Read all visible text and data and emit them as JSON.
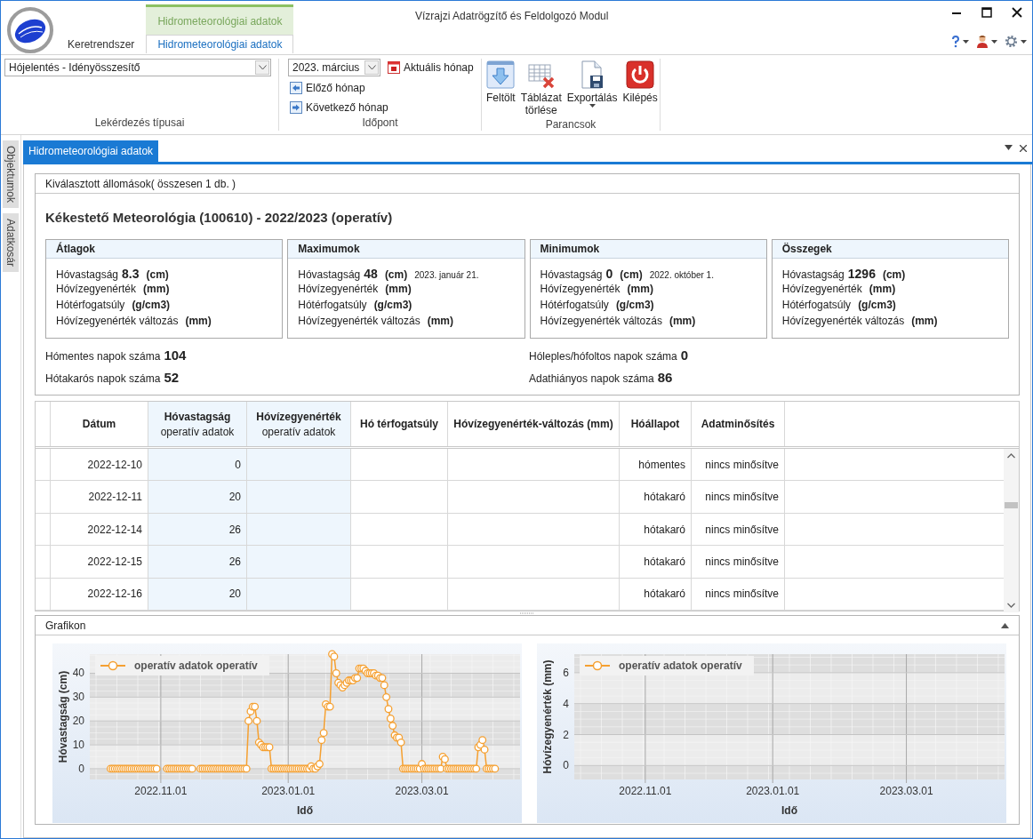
{
  "window": {
    "title": "Vízrajzi Adatrögzítő és Feldolgozó Modul"
  },
  "ribbon": {
    "context_tab_group": "Hidrometeorológiai adatok",
    "tabs": [
      {
        "label": "Keretrendszer",
        "selected": false
      },
      {
        "label": "Hidrometeorológiai adatok",
        "selected": true
      }
    ],
    "query_group": {
      "label": "Lekérdezés típusai",
      "dropdown": "Hójelentés - Idényösszesítő"
    },
    "date_group": {
      "label": "Időpont",
      "dropdown": "2023. március",
      "buttons": [
        "Aktuális hónap",
        "Előző hónap",
        "Következő hónap"
      ]
    },
    "commands_group": {
      "label": "Parancsok",
      "buttons": [
        {
          "label": "Feltölt",
          "has_menu": false
        },
        {
          "label": "Táblázat törlése",
          "has_menu": false
        },
        {
          "label": "Exportálás",
          "has_menu": true
        },
        {
          "label": "Kilépés",
          "has_menu": false
        }
      ]
    }
  },
  "side_tabs": [
    "Objektumok",
    "Adatkosár"
  ],
  "document_tab": {
    "label": "Hidrometeorológiai adatok"
  },
  "station_panel": {
    "header": "Kiválasztott állomások( összesen 1 db. )",
    "title": "Kékestető Meteorológia (100610) - 2022/2023 (operatív)",
    "cards": [
      {
        "title": "Átlagok",
        "rows": [
          {
            "label": "Hóvastagság",
            "value": "8.3",
            "unit": "(cm)"
          },
          {
            "label": "Hóvízegyenérték",
            "unit": "(mm)"
          },
          {
            "label": "Hótérfogatsúly",
            "unit": "(g/cm3)"
          },
          {
            "label": "Hóvízegyenérték változás",
            "unit": "(mm)"
          }
        ]
      },
      {
        "title": "Maximumok",
        "rows": [
          {
            "label": "Hóvastagság",
            "value": "48",
            "unit": "(cm)",
            "note": "2023. január 21."
          },
          {
            "label": "Hóvízegyenérték",
            "unit": "(mm)"
          },
          {
            "label": "Hótérfogatsúly",
            "unit": "(g/cm3)"
          },
          {
            "label": "Hóvízegyenérték változás",
            "unit": "(mm)"
          }
        ]
      },
      {
        "title": "Minimumok",
        "rows": [
          {
            "label": "Hóvastagság",
            "value": "0",
            "unit": "(cm)",
            "note": "2022. október 1."
          },
          {
            "label": "Hóvízegyenérték",
            "unit": "(mm)"
          },
          {
            "label": "Hótérfogatsúly",
            "unit": "(g/cm3)"
          },
          {
            "label": "Hóvízegyenérték változás",
            "unit": "(mm)"
          }
        ]
      },
      {
        "title": "Összegek",
        "rows": [
          {
            "label": "Hóvastagság",
            "value": "1296",
            "unit": "(cm)"
          },
          {
            "label": "Hóvízegyenérték",
            "unit": "(mm)"
          },
          {
            "label": "Hótérfogatsúly",
            "unit": "(g/cm3)"
          },
          {
            "label": "Hóvízegyenérték változás",
            "unit": "(mm)"
          }
        ]
      }
    ],
    "day_counts": [
      {
        "label": "Hómentes napok száma",
        "value": "104"
      },
      {
        "label": "Hóleples/hófoltos napok száma",
        "value": "0"
      },
      {
        "label": "Hótakarós napok száma",
        "value": "52"
      },
      {
        "label": "Adathiányos napok száma",
        "value": "86"
      }
    ]
  },
  "table": {
    "columns": [
      {
        "title": "Dátum",
        "highlighted": false
      },
      {
        "title": "Hóvastagság",
        "subtitle": "operatív adatok",
        "highlighted": true
      },
      {
        "title": "Hóvízegyenérték",
        "subtitle": "operatív adatok",
        "highlighted": true
      },
      {
        "title": "Hó térfogatsúly",
        "highlighted": false
      },
      {
        "title": "Hóvízegyenérték-változás (mm)",
        "highlighted": false
      },
      {
        "title": "Hóállapot",
        "highlighted": false
      },
      {
        "title": "Adatminősítés",
        "highlighted": false
      }
    ],
    "rows": [
      {
        "date": "2022-12-10",
        "snow_depth": "0",
        "snow_state": "hómentes",
        "qualification": "nincs minősítve"
      },
      {
        "date": "2022-12-11",
        "snow_depth": "20",
        "snow_state": "hótakaró",
        "qualification": "nincs minősítve"
      },
      {
        "date": "2022-12-14",
        "snow_depth": "26",
        "snow_state": "hótakaró",
        "qualification": "nincs minősítve"
      },
      {
        "date": "2022-12-15",
        "snow_depth": "26",
        "snow_state": "hótakaró",
        "qualification": "nincs minősítve"
      },
      {
        "date": "2022-12-16",
        "snow_depth": "20",
        "snow_state": "hótakaró",
        "qualification": "nincs minősítve"
      }
    ]
  },
  "chart_panel": {
    "title": "Grafikon",
    "charts": [
      {
        "chart_data": {
          "type": "line",
          "grid": true,
          "xlabel": "Idő",
          "ylabel": "Hóvastagság (cm)",
          "ylim": [
            -4.5,
            48
          ],
          "yticks": [
            0,
            10,
            20,
            30,
            40
          ],
          "categories": [
            null,
            null,
            null,
            null,
            null,
            null,
            null,
            null,
            null,
            null,
            null,
            null,
            null,
            null,
            null,
            null,
            null,
            null,
            null,
            null,
            null,
            null,
            null,
            null,
            null,
            null,
            null,
            null,
            null,
            null,
            null,
            "2022.11.01",
            null,
            null,
            null,
            null,
            null,
            null,
            null,
            null,
            null,
            null,
            null,
            null,
            null,
            null,
            null,
            null,
            null,
            null,
            null,
            null,
            null,
            null,
            null,
            null,
            null,
            null,
            null,
            null,
            null,
            null,
            null,
            null,
            null,
            null,
            null,
            null,
            null,
            null,
            null,
            null,
            null,
            null,
            null,
            null,
            null,
            null,
            null,
            null,
            null,
            null,
            null,
            null,
            null,
            null,
            null,
            null,
            null,
            null,
            null,
            null,
            "2023.01.01",
            null,
            null,
            null,
            null,
            null,
            null,
            null,
            null,
            null,
            null,
            null,
            null,
            null,
            null,
            null,
            null,
            null,
            null,
            null,
            null,
            null,
            null,
            null,
            null,
            null,
            null,
            null,
            null,
            null,
            null,
            null,
            null,
            null,
            null,
            null,
            null,
            null,
            null,
            null,
            null,
            null,
            null,
            null,
            null,
            null,
            null,
            null,
            null,
            null,
            null,
            null,
            null,
            null,
            null,
            null,
            null,
            null,
            null,
            null,
            null,
            null,
            null,
            null,
            "2023.03.01",
            null,
            null,
            null,
            null,
            null,
            null,
            null,
            null,
            null,
            null,
            null,
            null,
            null,
            null,
            null,
            null,
            null,
            null,
            null,
            null,
            null,
            null,
            null,
            null,
            null,
            null,
            null,
            null,
            null,
            null,
            null,
            null,
            null,
            null,
            null,
            null,
            null,
            null,
            null,
            null,
            null,
            null,
            null,
            null
          ],
          "series": [
            {
              "name": "operatív adatok operatív",
              "color": "#f5a031",
              "marker": "circle",
              "values": [
                null,
                null,
                null,
                null,
                null,
                null,
                null,
                0,
                0,
                0,
                0,
                0,
                0,
                0,
                0,
                0,
                0,
                0,
                0,
                0,
                0,
                0,
                0,
                0,
                0,
                0,
                0,
                0,
                0,
                0,
                null,
                null,
                null,
                null,
                0,
                0,
                0,
                0,
                0,
                0,
                0,
                0,
                0,
                0,
                0,
                0,
                0,
                null,
                null,
                null,
                0,
                0,
                0,
                0,
                0,
                0,
                0,
                0,
                0,
                0,
                0,
                0,
                0,
                0,
                0,
                0,
                0,
                0,
                0,
                0,
                0,
                0,
                0,
                20,
                24,
                26,
                26,
                20,
                11,
                10,
                9,
                9,
                9,
                9,
                0,
                0,
                0,
                0,
                0,
                0,
                0,
                0,
                0,
                0,
                0,
                0,
                0,
                0,
                0,
                0,
                0,
                0,
                0,
                1,
                0,
                0,
                1,
                2,
                12,
                15,
                27,
                26,
                26,
                48,
                47,
                40,
                36,
                35,
                34,
                35,
                36,
                37,
                37,
                37,
                38,
                38,
                42,
                42,
                42,
                41,
                40,
                40,
                40,
                40,
                39,
                39,
                38,
                38,
                35,
                30,
                25,
                21,
                18,
                14,
                13,
                13,
                11,
                0,
                0,
                0,
                0,
                0,
                0,
                0,
                0,
                0,
                2,
                0,
                0,
                0,
                0,
                0,
                0,
                0,
                0,
                0,
                5,
                4,
                0,
                0,
                0,
                0,
                0,
                0,
                0,
                0,
                0,
                0,
                0,
                0,
                0,
                0,
                0,
                9,
                10,
                12,
                8,
                0,
                0,
                0,
                0,
                0,
                null,
                null,
                null,
                null,
                null,
                null,
                null,
                null,
                null
              ]
            }
          ]
        }
      },
      {
        "chart_data": {
          "type": "line",
          "grid": true,
          "xlabel": "Idő",
          "ylabel": "Hóvízegyenérték (mm)",
          "ylim": [
            -0.9,
            7.2
          ],
          "yticks": [
            0,
            2,
            4,
            6
          ],
          "categories": [
            null,
            null,
            null,
            null,
            null,
            null,
            null,
            null,
            null,
            null,
            null,
            null,
            null,
            null,
            null,
            null,
            null,
            null,
            null,
            null,
            null,
            null,
            null,
            null,
            null,
            null,
            null,
            null,
            null,
            null,
            null,
            "2022.11.01",
            null,
            null,
            null,
            null,
            null,
            null,
            null,
            null,
            null,
            null,
            null,
            null,
            null,
            null,
            null,
            null,
            null,
            null,
            null,
            null,
            null,
            null,
            null,
            null,
            null,
            null,
            null,
            null,
            null,
            null,
            null,
            null,
            null,
            null,
            null,
            null,
            null,
            null,
            null,
            null,
            null,
            null,
            null,
            null,
            null,
            null,
            null,
            null,
            null,
            null,
            null,
            null,
            null,
            null,
            null,
            null,
            null,
            null,
            null,
            null,
            "2023.01.01",
            null,
            null,
            null,
            null,
            null,
            null,
            null,
            null,
            null,
            null,
            null,
            null,
            null,
            null,
            null,
            null,
            null,
            null,
            null,
            null,
            null,
            null,
            null,
            null,
            null,
            null,
            null,
            null,
            null,
            null,
            null,
            null,
            null,
            null,
            null,
            null,
            null,
            null,
            null,
            null,
            null,
            null,
            null,
            null,
            null,
            null,
            null,
            null,
            null,
            null,
            null,
            null,
            null,
            null,
            null,
            null,
            null,
            null,
            null,
            null,
            null,
            null,
            null,
            "2023.03.01",
            null,
            null,
            null,
            null,
            null,
            null,
            null,
            null,
            null,
            null,
            null,
            null,
            null,
            null,
            null,
            null,
            null,
            null,
            null,
            null,
            null,
            null,
            null,
            null,
            null,
            null,
            null,
            null,
            null,
            null,
            null,
            null,
            null,
            null,
            null,
            null,
            null,
            null,
            null,
            null,
            null,
            null,
            null,
            null
          ],
          "series": [
            {
              "name": "operatív adatok operatív",
              "color": "#f5a031",
              "marker": "circle",
              "values": [
                null,
                null,
                null,
                null,
                null,
                null,
                null,
                null,
                null,
                null,
                null,
                null,
                null,
                null,
                null,
                null,
                null,
                null,
                null,
                null,
                null,
                null,
                null,
                null,
                null,
                null,
                null,
                null,
                null,
                null,
                null,
                null,
                null,
                null,
                null,
                null,
                null,
                null,
                null,
                null,
                null,
                null,
                null,
                null,
                null,
                null,
                null,
                null,
                null,
                null,
                null,
                null,
                null,
                null,
                null,
                null,
                null,
                null,
                null,
                null,
                null,
                null,
                null,
                null,
                null,
                null,
                null,
                null,
                null,
                null,
                null,
                null,
                null,
                null,
                null,
                null,
                null,
                null,
                null,
                null,
                null,
                null,
                null,
                null,
                null,
                null,
                null,
                null,
                null,
                null,
                null,
                null,
                null,
                null,
                null,
                null,
                null,
                null,
                null,
                null,
                null,
                null,
                null,
                null,
                null,
                null,
                null,
                null,
                null,
                null,
                null,
                null,
                null,
                null,
                null,
                null,
                null,
                null,
                null,
                null,
                null,
                null,
                null,
                null,
                null,
                null,
                null,
                null,
                null,
                null,
                null,
                null,
                null,
                null,
                null,
                null,
                null,
                null,
                null,
                null,
                null,
                null,
                null,
                null,
                null,
                null,
                null,
                null,
                null,
                null,
                null,
                null,
                null,
                null,
                null,
                null,
                null,
                null,
                null,
                null,
                null,
                null,
                null,
                null,
                null,
                null,
                null,
                null,
                null,
                null,
                null,
                null,
                null,
                null,
                null,
                null,
                null,
                null,
                null,
                null,
                null,
                null,
                null,
                null,
                null,
                null,
                null,
                null,
                null,
                null,
                null,
                null,
                null,
                null,
                null,
                null,
                null,
                null,
                null,
                null,
                null
              ]
            }
          ]
        }
      }
    ]
  }
}
